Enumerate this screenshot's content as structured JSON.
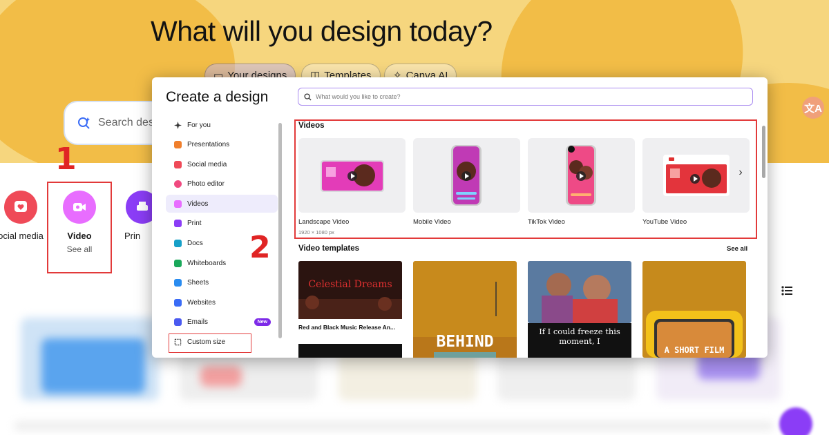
{
  "page": {
    "heading": "What will you design today?",
    "tabs": [
      {
        "label": "Your designs",
        "icon": "folder-icon"
      },
      {
        "label": "Templates",
        "icon": "template-icon"
      },
      {
        "label": "Canva AI",
        "icon": "sparkle-icon"
      }
    ],
    "search_placeholder": "Search des",
    "categories": [
      {
        "label": "ocial media",
        "sub": ""
      },
      {
        "label": "Video",
        "sub": "See all"
      },
      {
        "label": "Prin",
        "sub": ""
      }
    ],
    "annotations": {
      "step1": "1",
      "step2": "2"
    }
  },
  "modal": {
    "title": "Create a design",
    "search_placeholder": "What would you like to create?",
    "sidebar": [
      {
        "label": "For you",
        "icon": "sparkle-icon",
        "color": "#333333"
      },
      {
        "label": "Presentations",
        "icon": "presentation-icon",
        "color": "#f07f2c"
      },
      {
        "label": "Social media",
        "icon": "heart-icon",
        "color": "#ef4a58"
      },
      {
        "label": "Photo editor",
        "icon": "camera-icon",
        "color": "#f04a80"
      },
      {
        "label": "Videos",
        "icon": "video-icon",
        "color": "#e86dff"
      },
      {
        "label": "Print",
        "icon": "printer-icon",
        "color": "#8b3df6"
      },
      {
        "label": "Docs",
        "icon": "doc-icon",
        "color": "#16a0c8"
      },
      {
        "label": "Whiteboards",
        "icon": "whiteboard-icon",
        "color": "#1aa85a"
      },
      {
        "label": "Sheets",
        "icon": "sheet-icon",
        "color": "#2a8cf0"
      },
      {
        "label": "Websites",
        "icon": "website-icon",
        "color": "#3a6cf6"
      },
      {
        "label": "Emails",
        "icon": "email-icon",
        "color": "#4a5af0",
        "badge": "New"
      },
      {
        "label": "Custom size",
        "icon": "custom-size-icon",
        "color": "#222222"
      }
    ],
    "videos": {
      "title": "Videos",
      "items": [
        {
          "label": "Landscape Video",
          "sub": "1920 × 1080 px"
        },
        {
          "label": "Mobile Video",
          "sub": ""
        },
        {
          "label": "TikTok Video",
          "sub": ""
        },
        {
          "label": "YouTube Video",
          "sub": ""
        }
      ]
    },
    "templates": {
      "title": "Video templates",
      "see_all": "See all",
      "items": [
        {
          "label": "Red and Black Music Release An...",
          "art": "Celestial Dreams"
        },
        {
          "label": "",
          "art": "BEHIND"
        },
        {
          "label": "",
          "art": "If I could freeze this moment, I"
        },
        {
          "label": "",
          "art": "A SHORT FILM"
        }
      ]
    }
  },
  "colors": {
    "accent": "#7d2ae8",
    "annotation_red": "#e02424",
    "hero_bg": "#f6d67e"
  }
}
